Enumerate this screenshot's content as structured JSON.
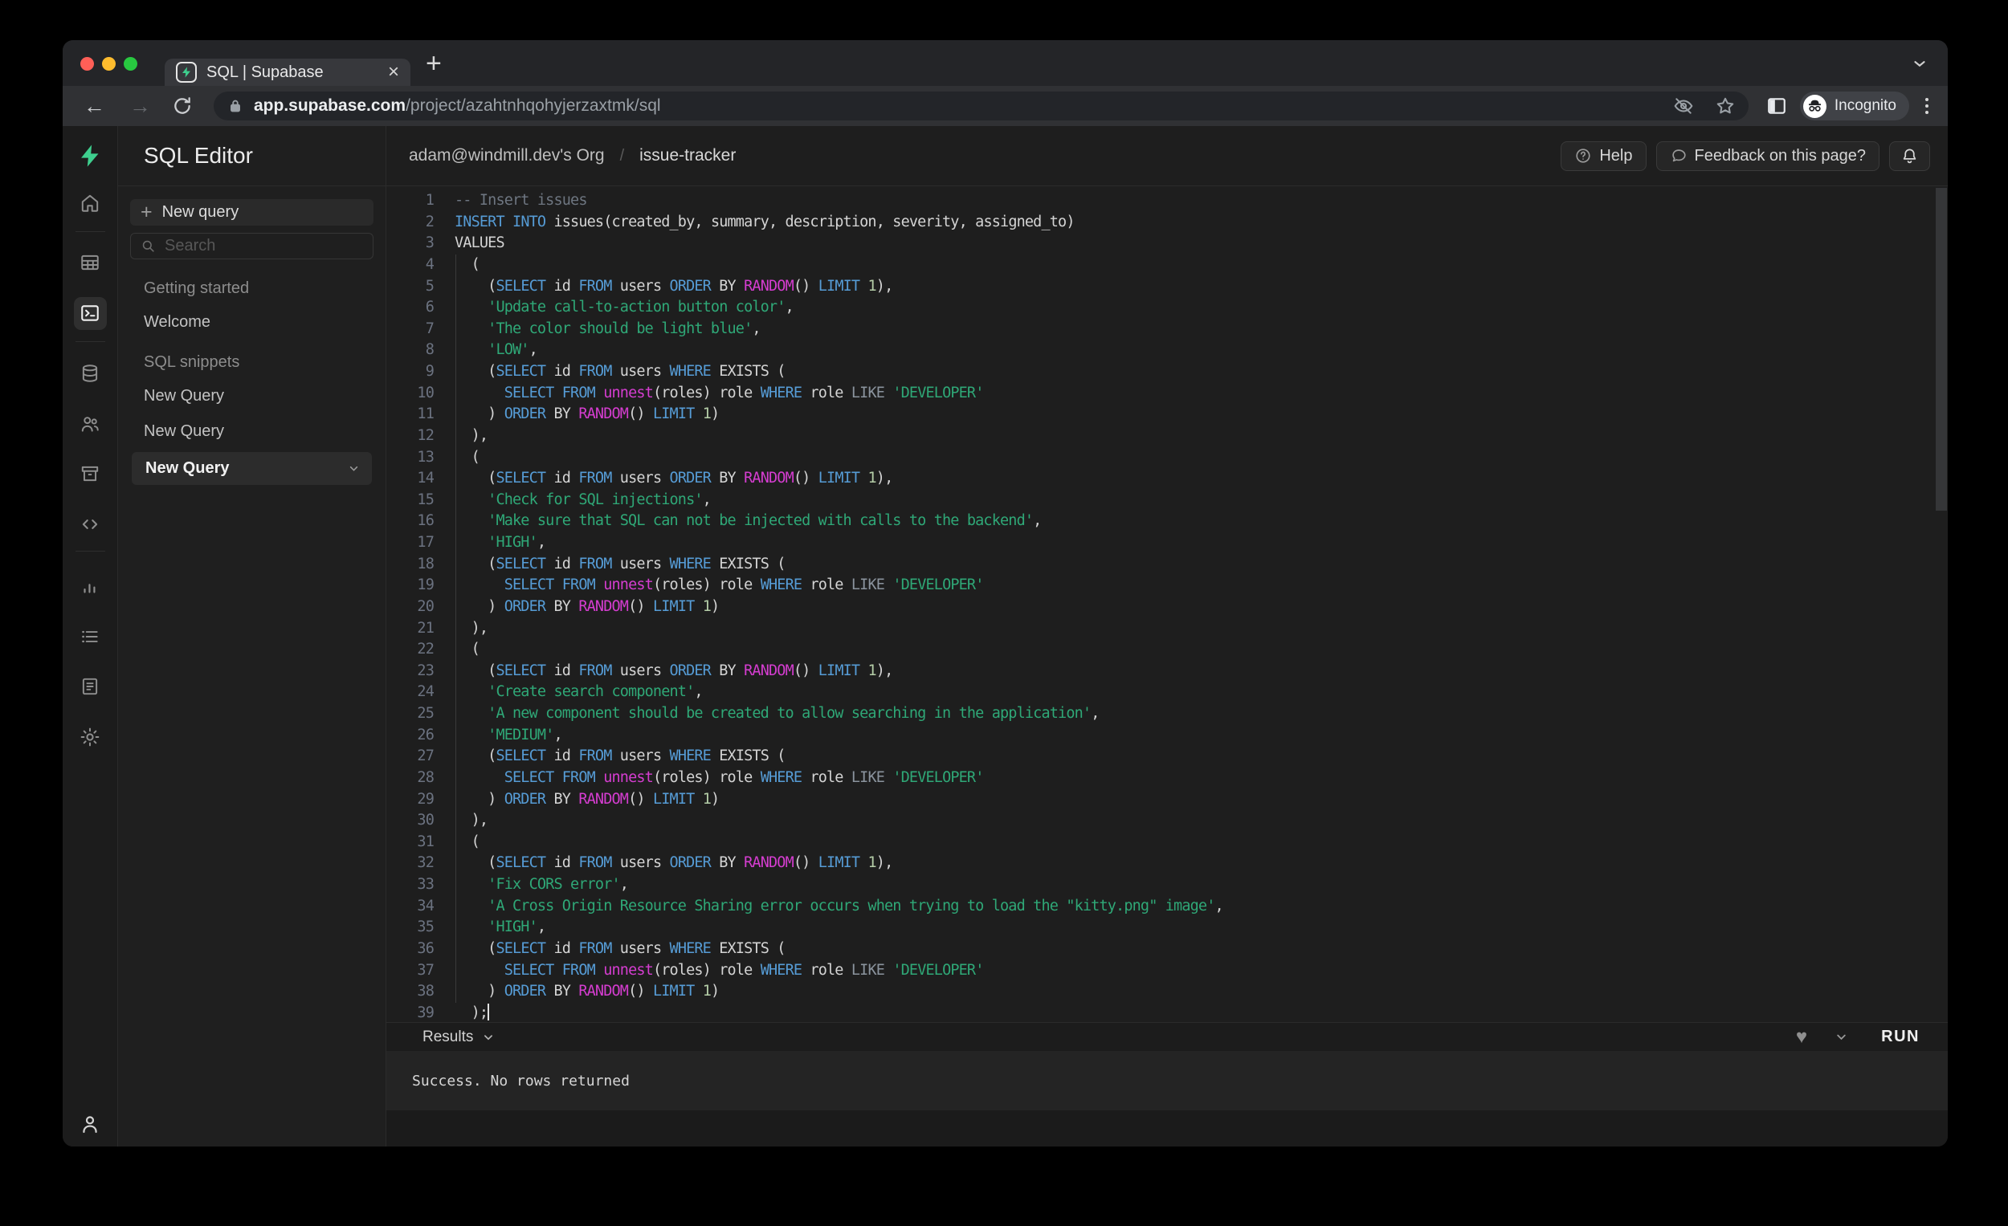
{
  "browser": {
    "tab_title": "SQL | Supabase",
    "url_host": "app.supabase.com",
    "url_path": "/project/azahtnhqohyjerzaxtmk/sql",
    "incognito_label": "Incognito"
  },
  "header": {
    "app_title": "SQL Editor",
    "breadcrumb_org": "adam@windmill.dev's Org",
    "breadcrumb_sep": "/",
    "breadcrumb_project": "issue-tracker",
    "help_label": "Help",
    "feedback_label": "Feedback on this page?"
  },
  "sidebar": {
    "new_query_label": "New query",
    "plus_glyph": "+",
    "search_placeholder": "Search",
    "sections": [
      {
        "label": "Getting started",
        "items": [
          {
            "label": "Welcome",
            "active": false
          }
        ]
      },
      {
        "label": "SQL snippets",
        "items": [
          {
            "label": "New Query",
            "active": false
          },
          {
            "label": "New Query",
            "active": false
          },
          {
            "label": "New Query",
            "active": true
          }
        ]
      }
    ]
  },
  "icons": {
    "rail": [
      "home-icon",
      "table-editor-icon",
      "sql-editor-icon",
      "database-icon",
      "auth-users-icon",
      "storage-icon",
      "edge-functions-icon",
      "reports-icon",
      "logs-icon",
      "api-docs-icon",
      "settings-icon",
      "account-icon"
    ]
  },
  "colors": {
    "brand_green": "#3ecf8e",
    "syntax": {
      "keyword": "#569cd6",
      "function": "#d53dd0",
      "string": "#2fa877",
      "number": "#b5cea8",
      "comment": "#6e7681",
      "plain": "#d4d4d4",
      "operator_gray": "#8b949e",
      "line_number": "#6b7280"
    },
    "traffic_lights": [
      "#ff5f57",
      "#febc2e",
      "#28c840"
    ]
  },
  "editor": {
    "lines": [
      {
        "n": 1,
        "t": [
          [
            "c",
            "-- Insert issues"
          ]
        ]
      },
      {
        "n": 2,
        "t": [
          [
            "k",
            "INSERT"
          ],
          [
            "p",
            " "
          ],
          [
            "k",
            "INTO"
          ],
          [
            "p",
            " issues(created_by, summary, description, severity, assigned_to)"
          ]
        ]
      },
      {
        "n": 3,
        "t": [
          [
            "p",
            "VALUES"
          ]
        ]
      },
      {
        "n": 4,
        "t": [
          [
            "p",
            "  ("
          ]
        ]
      },
      {
        "n": 5,
        "t": [
          [
            "p",
            "    ("
          ],
          [
            "k",
            "SELECT"
          ],
          [
            "p",
            " id "
          ],
          [
            "k",
            "FROM"
          ],
          [
            "p",
            " users "
          ],
          [
            "k",
            "ORDER"
          ],
          [
            "p",
            " BY "
          ],
          [
            "f",
            "RANDOM"
          ],
          [
            "p",
            "() "
          ],
          [
            "k",
            "LIMIT"
          ],
          [
            "p",
            " "
          ],
          [
            "n2",
            "1"
          ],
          [
            "p",
            "),"
          ]
        ]
      },
      {
        "n": 6,
        "t": [
          [
            "p",
            "    "
          ],
          [
            "s",
            "'Update call-to-action button color'"
          ],
          [
            "p",
            ","
          ]
        ]
      },
      {
        "n": 7,
        "t": [
          [
            "p",
            "    "
          ],
          [
            "s",
            "'The color should be light blue'"
          ],
          [
            "p",
            ","
          ]
        ]
      },
      {
        "n": 8,
        "t": [
          [
            "p",
            "    "
          ],
          [
            "s",
            "'LOW'"
          ],
          [
            "p",
            ","
          ]
        ]
      },
      {
        "n": 9,
        "t": [
          [
            "p",
            "    ("
          ],
          [
            "k",
            "SELECT"
          ],
          [
            "p",
            " id "
          ],
          [
            "k",
            "FROM"
          ],
          [
            "p",
            " users "
          ],
          [
            "k",
            "WHERE"
          ],
          [
            "p",
            " EXISTS ("
          ]
        ]
      },
      {
        "n": 10,
        "t": [
          [
            "p",
            "      "
          ],
          [
            "k",
            "SELECT"
          ],
          [
            "p",
            " "
          ],
          [
            "k",
            "FROM"
          ],
          [
            "p",
            " "
          ],
          [
            "f",
            "unnest"
          ],
          [
            "p",
            "(roles) role "
          ],
          [
            "k",
            "WHERE"
          ],
          [
            "p",
            " role "
          ],
          [
            "g",
            "LIKE"
          ],
          [
            "p",
            " "
          ],
          [
            "s",
            "'DEVELOPER'"
          ]
        ]
      },
      {
        "n": 11,
        "t": [
          [
            "p",
            "    ) "
          ],
          [
            "k",
            "ORDER"
          ],
          [
            "p",
            " BY "
          ],
          [
            "f",
            "RANDOM"
          ],
          [
            "p",
            "() "
          ],
          [
            "k",
            "LIMIT"
          ],
          [
            "p",
            " "
          ],
          [
            "n2",
            "1"
          ],
          [
            "p",
            ")"
          ]
        ]
      },
      {
        "n": 12,
        "t": [
          [
            "p",
            "  ),"
          ]
        ]
      },
      {
        "n": 13,
        "t": [
          [
            "p",
            "  ("
          ]
        ]
      },
      {
        "n": 14,
        "t": [
          [
            "p",
            "    ("
          ],
          [
            "k",
            "SELECT"
          ],
          [
            "p",
            " id "
          ],
          [
            "k",
            "FROM"
          ],
          [
            "p",
            " users "
          ],
          [
            "k",
            "ORDER"
          ],
          [
            "p",
            " BY "
          ],
          [
            "f",
            "RANDOM"
          ],
          [
            "p",
            "() "
          ],
          [
            "k",
            "LIMIT"
          ],
          [
            "p",
            " "
          ],
          [
            "n2",
            "1"
          ],
          [
            "p",
            "),"
          ]
        ]
      },
      {
        "n": 15,
        "t": [
          [
            "p",
            "    "
          ],
          [
            "s",
            "'Check for SQL injections'"
          ],
          [
            "p",
            ","
          ]
        ]
      },
      {
        "n": 16,
        "t": [
          [
            "p",
            "    "
          ],
          [
            "s",
            "'Make sure that SQL can not be injected with calls to the backend'"
          ],
          [
            "p",
            ","
          ]
        ]
      },
      {
        "n": 17,
        "t": [
          [
            "p",
            "    "
          ],
          [
            "s",
            "'HIGH'"
          ],
          [
            "p",
            ","
          ]
        ]
      },
      {
        "n": 18,
        "t": [
          [
            "p",
            "    ("
          ],
          [
            "k",
            "SELECT"
          ],
          [
            "p",
            " id "
          ],
          [
            "k",
            "FROM"
          ],
          [
            "p",
            " users "
          ],
          [
            "k",
            "WHERE"
          ],
          [
            "p",
            " EXISTS ("
          ]
        ]
      },
      {
        "n": 19,
        "t": [
          [
            "p",
            "      "
          ],
          [
            "k",
            "SELECT"
          ],
          [
            "p",
            " "
          ],
          [
            "k",
            "FROM"
          ],
          [
            "p",
            " "
          ],
          [
            "f",
            "unnest"
          ],
          [
            "p",
            "(roles) role "
          ],
          [
            "k",
            "WHERE"
          ],
          [
            "p",
            " role "
          ],
          [
            "g",
            "LIKE"
          ],
          [
            "p",
            " "
          ],
          [
            "s",
            "'DEVELOPER'"
          ]
        ]
      },
      {
        "n": 20,
        "t": [
          [
            "p",
            "    ) "
          ],
          [
            "k",
            "ORDER"
          ],
          [
            "p",
            " BY "
          ],
          [
            "f",
            "RANDOM"
          ],
          [
            "p",
            "() "
          ],
          [
            "k",
            "LIMIT"
          ],
          [
            "p",
            " "
          ],
          [
            "n2",
            "1"
          ],
          [
            "p",
            ")"
          ]
        ]
      },
      {
        "n": 21,
        "t": [
          [
            "p",
            "  ),"
          ]
        ]
      },
      {
        "n": 22,
        "t": [
          [
            "p",
            "  ("
          ]
        ]
      },
      {
        "n": 23,
        "t": [
          [
            "p",
            "    ("
          ],
          [
            "k",
            "SELECT"
          ],
          [
            "p",
            " id "
          ],
          [
            "k",
            "FROM"
          ],
          [
            "p",
            " users "
          ],
          [
            "k",
            "ORDER"
          ],
          [
            "p",
            " BY "
          ],
          [
            "f",
            "RANDOM"
          ],
          [
            "p",
            "() "
          ],
          [
            "k",
            "LIMIT"
          ],
          [
            "p",
            " "
          ],
          [
            "n2",
            "1"
          ],
          [
            "p",
            "),"
          ]
        ]
      },
      {
        "n": 24,
        "t": [
          [
            "p",
            "    "
          ],
          [
            "s",
            "'Create search component'"
          ],
          [
            "p",
            ","
          ]
        ]
      },
      {
        "n": 25,
        "t": [
          [
            "p",
            "    "
          ],
          [
            "s",
            "'A new component should be created to allow searching in the application'"
          ],
          [
            "p",
            ","
          ]
        ]
      },
      {
        "n": 26,
        "t": [
          [
            "p",
            "    "
          ],
          [
            "s",
            "'MEDIUM'"
          ],
          [
            "p",
            ","
          ]
        ]
      },
      {
        "n": 27,
        "t": [
          [
            "p",
            "    ("
          ],
          [
            "k",
            "SELECT"
          ],
          [
            "p",
            " id "
          ],
          [
            "k",
            "FROM"
          ],
          [
            "p",
            " users "
          ],
          [
            "k",
            "WHERE"
          ],
          [
            "p",
            " EXISTS ("
          ]
        ]
      },
      {
        "n": 28,
        "t": [
          [
            "p",
            "      "
          ],
          [
            "k",
            "SELECT"
          ],
          [
            "p",
            " "
          ],
          [
            "k",
            "FROM"
          ],
          [
            "p",
            " "
          ],
          [
            "f",
            "unnest"
          ],
          [
            "p",
            "(roles) role "
          ],
          [
            "k",
            "WHERE"
          ],
          [
            "p",
            " role "
          ],
          [
            "g",
            "LIKE"
          ],
          [
            "p",
            " "
          ],
          [
            "s",
            "'DEVELOPER'"
          ]
        ]
      },
      {
        "n": 29,
        "t": [
          [
            "p",
            "    ) "
          ],
          [
            "k",
            "ORDER"
          ],
          [
            "p",
            " BY "
          ],
          [
            "f",
            "RANDOM"
          ],
          [
            "p",
            "() "
          ],
          [
            "k",
            "LIMIT"
          ],
          [
            "p",
            " "
          ],
          [
            "n2",
            "1"
          ],
          [
            "p",
            ")"
          ]
        ]
      },
      {
        "n": 30,
        "t": [
          [
            "p",
            "  ),"
          ]
        ]
      },
      {
        "n": 31,
        "t": [
          [
            "p",
            "  ("
          ]
        ]
      },
      {
        "n": 32,
        "t": [
          [
            "p",
            "    ("
          ],
          [
            "k",
            "SELECT"
          ],
          [
            "p",
            " id "
          ],
          [
            "k",
            "FROM"
          ],
          [
            "p",
            " users "
          ],
          [
            "k",
            "ORDER"
          ],
          [
            "p",
            " BY "
          ],
          [
            "f",
            "RANDOM"
          ],
          [
            "p",
            "() "
          ],
          [
            "k",
            "LIMIT"
          ],
          [
            "p",
            " "
          ],
          [
            "n2",
            "1"
          ],
          [
            "p",
            "),"
          ]
        ]
      },
      {
        "n": 33,
        "t": [
          [
            "p",
            "    "
          ],
          [
            "s",
            "'Fix CORS error'"
          ],
          [
            "p",
            ","
          ]
        ]
      },
      {
        "n": 34,
        "t": [
          [
            "p",
            "    "
          ],
          [
            "s",
            "'A Cross Origin Resource Sharing error occurs when trying to load the \"kitty.png\" image'"
          ],
          [
            "p",
            ","
          ]
        ]
      },
      {
        "n": 35,
        "t": [
          [
            "p",
            "    "
          ],
          [
            "s",
            "'HIGH'"
          ],
          [
            "p",
            ","
          ]
        ]
      },
      {
        "n": 36,
        "t": [
          [
            "p",
            "    ("
          ],
          [
            "k",
            "SELECT"
          ],
          [
            "p",
            " id "
          ],
          [
            "k",
            "FROM"
          ],
          [
            "p",
            " users "
          ],
          [
            "k",
            "WHERE"
          ],
          [
            "p",
            " EXISTS ("
          ]
        ]
      },
      {
        "n": 37,
        "t": [
          [
            "p",
            "      "
          ],
          [
            "k",
            "SELECT"
          ],
          [
            "p",
            " "
          ],
          [
            "k",
            "FROM"
          ],
          [
            "p",
            " "
          ],
          [
            "f",
            "unnest"
          ],
          [
            "p",
            "(roles) role "
          ],
          [
            "k",
            "WHERE"
          ],
          [
            "p",
            " role "
          ],
          [
            "g",
            "LIKE"
          ],
          [
            "p",
            " "
          ],
          [
            "s",
            "'DEVELOPER'"
          ]
        ]
      },
      {
        "n": 38,
        "t": [
          [
            "p",
            "    ) "
          ],
          [
            "k",
            "ORDER"
          ],
          [
            "p",
            " BY "
          ],
          [
            "f",
            "RANDOM"
          ],
          [
            "p",
            "() "
          ],
          [
            "k",
            "LIMIT"
          ],
          [
            "p",
            " "
          ],
          [
            "n2",
            "1"
          ],
          [
            "p",
            ")"
          ]
        ]
      },
      {
        "n": 39,
        "t": [
          [
            "p",
            "  );"
          ]
        ],
        "cursor": true
      }
    ]
  },
  "results": {
    "label": "Results",
    "message": "Success. No rows returned",
    "run_label": "RUN"
  }
}
